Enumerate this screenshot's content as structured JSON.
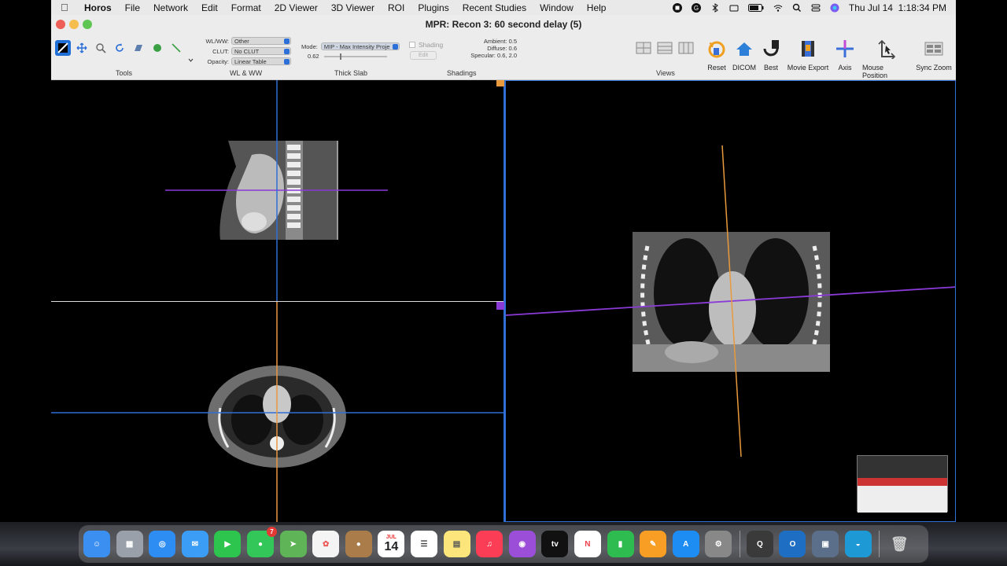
{
  "menubar": {
    "app": "Horos",
    "items": [
      "File",
      "Network",
      "Edit",
      "Format",
      "2D Viewer",
      "3D Viewer",
      "ROI",
      "Plugins",
      "Recent Studies",
      "Window",
      "Help"
    ],
    "clock": "Thu Jul 14  1:18:34 PM"
  },
  "window": {
    "title": "MPR: Recon 3: 60 second delay (5)"
  },
  "toolbar": {
    "groups": {
      "tools": "Tools",
      "wlww": "WL & WW",
      "thick_slab": "Thick Slab",
      "shadings": "Shadings",
      "views": "Views"
    },
    "wl": {
      "label": "WL/WW:",
      "value": "Other"
    },
    "clut": {
      "label": "CLUT:",
      "value": "No CLUT"
    },
    "opacity": {
      "label": "Opacity:",
      "value": "Linear Table"
    },
    "mode": {
      "label": "Mode:",
      "value": "MIP - Max Intensity Proje"
    },
    "slab_value": "0.62",
    "shading": {
      "label": "Shading",
      "edit": "Edit"
    },
    "lighting": {
      "ambient": "Ambient: 0.5",
      "diffuse": "Diffuse: 0.6",
      "specular": "Specular: 0.6, 2.0"
    },
    "buttons": [
      "Reset",
      "DICOM",
      "Best",
      "Movie Export",
      "Axis",
      "Mouse Position",
      "Sync Zoom"
    ]
  },
  "dock": {
    "calendar_month": "JUL",
    "calendar_day": "14",
    "messages_badge": "7",
    "tv_label": "tv"
  },
  "colors": {
    "axial_line": "#2f6fd6",
    "sagittal_line": "#e89a3c",
    "coronal_line": "#8a3ad6",
    "close": "#ee5f57",
    "minimize": "#f5be4f",
    "zoom": "#5fc553"
  }
}
